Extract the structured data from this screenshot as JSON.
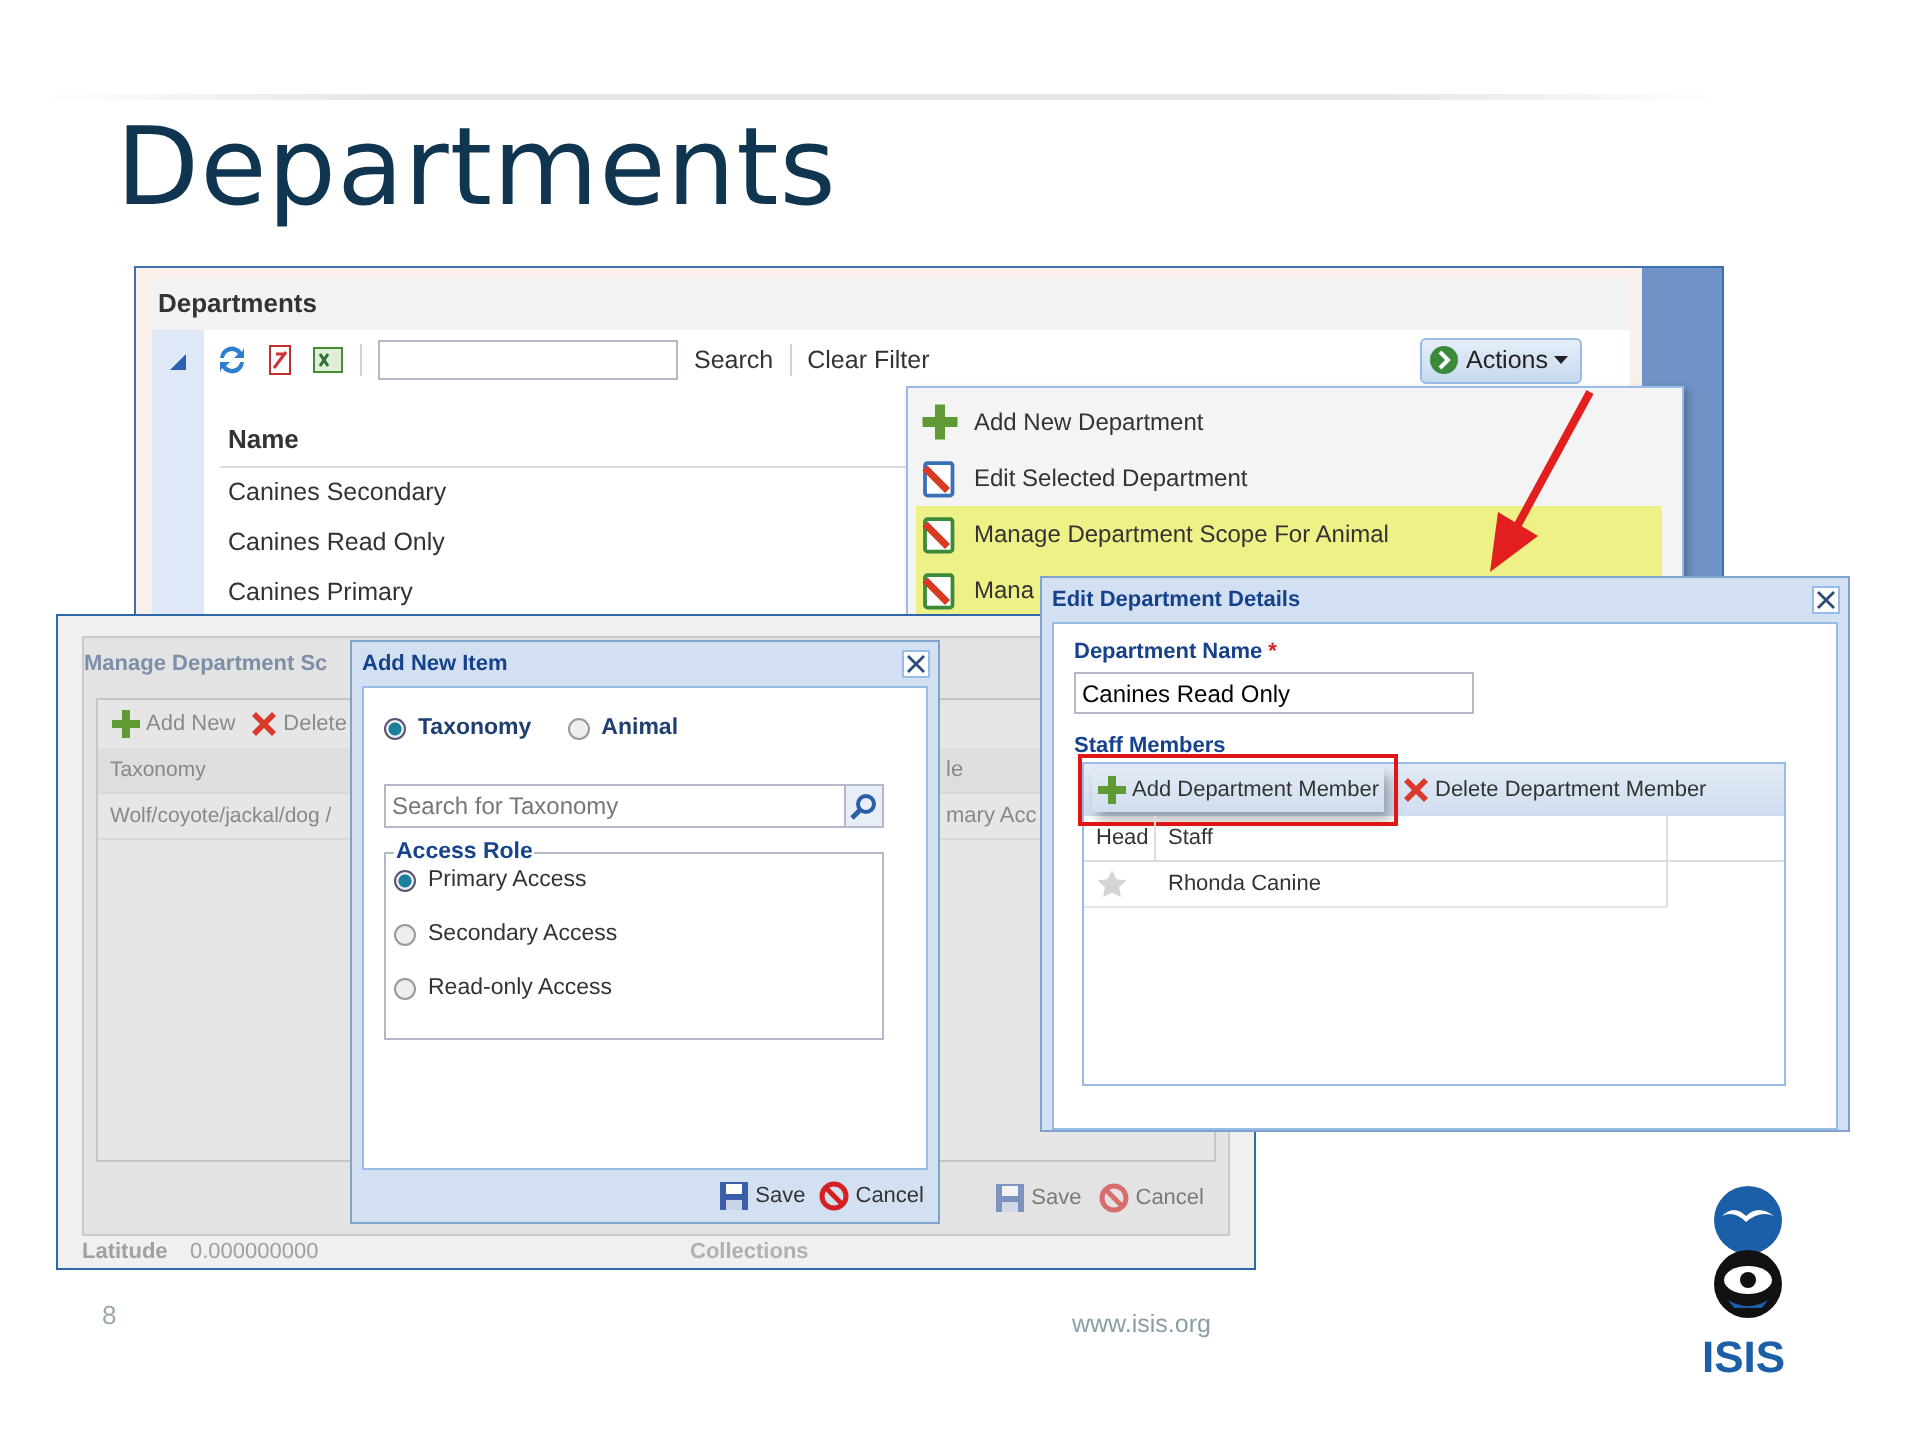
{
  "slide": {
    "title": "Departments",
    "page_number": "8",
    "url": "www.isis.org",
    "logo_text": "ISIS"
  },
  "departments_window": {
    "title": "Departments",
    "search_button": "Search",
    "clear_filter": "Clear Filter",
    "actions_button": "Actions",
    "columns": [
      "Name"
    ],
    "rows": [
      "Canines Secondary",
      "Canines Read Only",
      "Canines Primary"
    ]
  },
  "actions_menu": {
    "items": [
      {
        "label": "Add New Department",
        "kind": "add",
        "highlighted": false
      },
      {
        "label": "Edit Selected Department",
        "kind": "edit",
        "highlighted": false
      },
      {
        "label": "Manage Department Scope For Animal",
        "kind": "scope",
        "highlighted": true
      },
      {
        "label": "Mana",
        "kind": "scope",
        "highlighted": true
      }
    ]
  },
  "scope_window": {
    "title": "Manage Department Sc",
    "toolbar": [
      {
        "label": "Add New",
        "kind": "add"
      },
      {
        "label": "Delete",
        "kind": "delete"
      }
    ],
    "columns": [
      "Taxonomy",
      "le"
    ],
    "rows": [
      [
        "Wolf/coyote/jackal/dog /",
        "mary Acc"
      ]
    ],
    "save": "Save",
    "cancel": "Cancel",
    "latitude_label": "Latitude",
    "latitude_value": "0.000000000",
    "collections": "Collections"
  },
  "add_item_dialog": {
    "title": "Add New Item",
    "type_options": [
      {
        "label": "Taxonomy",
        "selected": true
      },
      {
        "label": "Animal",
        "selected": false
      }
    ],
    "search": {
      "placeholder": "Search for Taxonomy"
    },
    "access_role": {
      "legend": "Access Role",
      "options": [
        {
          "label": "Primary Access",
          "selected": true
        },
        {
          "label": "Secondary Access",
          "selected": false
        },
        {
          "label": "Read-only Access",
          "selected": false
        }
      ]
    },
    "save": "Save",
    "cancel": "Cancel"
  },
  "edit_dialog": {
    "title": "Edit Department Details",
    "name_label": "Department Name",
    "required_mark": "*",
    "name_value": "Canines Read Only",
    "staff_label": "Staff Members",
    "toolbar": [
      {
        "label": "Add Department Member",
        "kind": "add",
        "highlighted": true
      },
      {
        "label": "Delete Department Member",
        "kind": "delete",
        "highlighted": false
      }
    ],
    "columns": [
      "Head",
      "Staff"
    ],
    "rows": [
      {
        "head": false,
        "staff": "Rhonda Canine"
      }
    ]
  }
}
